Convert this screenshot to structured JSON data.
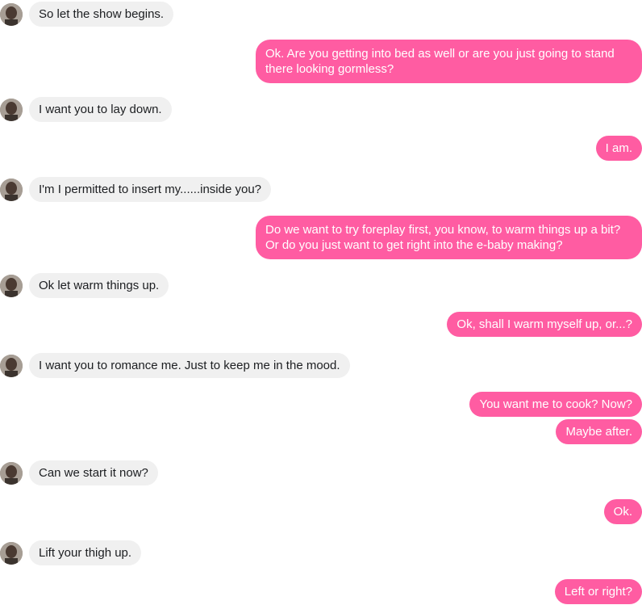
{
  "conversation": {
    "messages": [
      {
        "from": "them",
        "text": "So let the show begins."
      },
      {
        "from": "me",
        "text": "Ok. Are you getting into bed as well or are you just going to stand there looking gormless?"
      },
      {
        "from": "them",
        "text": "I want you to lay down."
      },
      {
        "from": "me",
        "text": "I am."
      },
      {
        "from": "them",
        "text": "I'm I permitted to insert my......inside you?"
      },
      {
        "from": "me",
        "text": "Do we want to try foreplay first, you know, to warm things up a bit? Or do you just want to get right into the e-baby making?"
      },
      {
        "from": "them",
        "text": "Ok let warm things up."
      },
      {
        "from": "me",
        "text": "Ok, shall I warm myself up, or...?"
      },
      {
        "from": "them",
        "text": "I want you to romance me. Just to keep me in the mood."
      },
      {
        "from": "me",
        "text": "You want me to cook? Now?"
      },
      {
        "from": "me",
        "text": "Maybe after."
      },
      {
        "from": "them",
        "text": "Can we start it now?"
      },
      {
        "from": "me",
        "text": "Ok."
      },
      {
        "from": "them",
        "text": "Lift your thigh up."
      },
      {
        "from": "me",
        "text": "Left or right?"
      }
    ]
  },
  "colors": {
    "outgoing_bubble": "#ff5ca2",
    "incoming_bubble": "#f0f0f0"
  }
}
